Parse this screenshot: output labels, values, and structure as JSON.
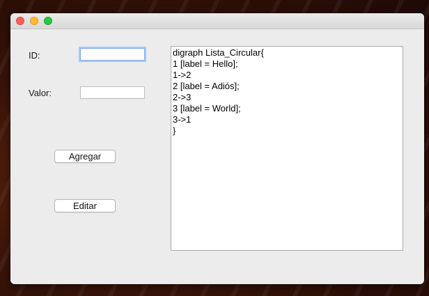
{
  "form": {
    "id_label": "ID:",
    "id_value": "",
    "valor_label": "Valor:",
    "valor_value": ""
  },
  "buttons": {
    "agregar": "Agregar",
    "editar": "Editar"
  },
  "output": {
    "lines": [
      "digraph Lista_Circular{",
      "1 [label = Hello];",
      "1->2",
      "2 [label = Adiós];",
      "2->3",
      "3 [label = World];",
      "3->1",
      "}"
    ]
  }
}
